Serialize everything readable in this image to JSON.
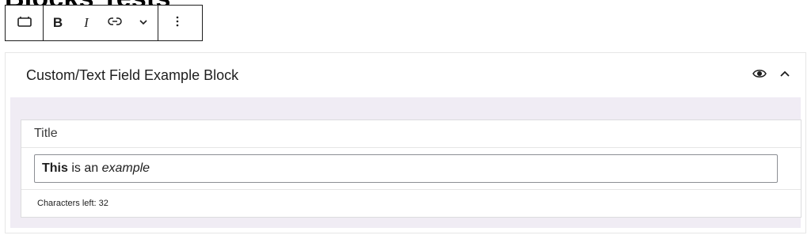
{
  "page": {
    "title": "Blocks Tests"
  },
  "toolbar": {
    "block_icon": "block-type-icon",
    "bold_label": "B",
    "italic_label": "I",
    "link_icon": "link-icon",
    "more_formats_icon": "chevron-down-icon",
    "options_icon": "more-vertical-icon"
  },
  "block": {
    "title": "Custom/Text Field Example Block",
    "preview_icon": "eye-icon",
    "collapse_icon": "chevron-up-icon",
    "field": {
      "label": "Title",
      "value_bold": "This",
      "value_plain": " is an ",
      "value_italic": "example",
      "footer": "Characters left: 32"
    }
  }
}
